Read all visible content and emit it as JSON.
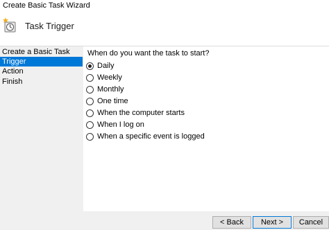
{
  "window": {
    "title": "Create Basic Task Wizard"
  },
  "header": {
    "icon": "task-scheduler-clock-icon",
    "heading": "Task Trigger"
  },
  "sidebar": {
    "items": [
      {
        "label": "Create a Basic Task",
        "selected": false
      },
      {
        "label": "Trigger",
        "selected": true
      },
      {
        "label": "Action",
        "selected": false
      },
      {
        "label": "Finish",
        "selected": false
      }
    ]
  },
  "main": {
    "question": "When do you want the task to start?",
    "options": [
      {
        "label": "Daily",
        "checked": true
      },
      {
        "label": "Weekly",
        "checked": false
      },
      {
        "label": "Monthly",
        "checked": false
      },
      {
        "label": "One time",
        "checked": false
      },
      {
        "label": "When the computer starts",
        "checked": false
      },
      {
        "label": "When I log on",
        "checked": false
      },
      {
        "label": "When a specific event is logged",
        "checked": false
      }
    ]
  },
  "footer": {
    "back_label": "< Back",
    "next_label": "Next >",
    "cancel_label": "Cancel"
  },
  "colors": {
    "selection": "#0078d7",
    "panel": "#ffffff",
    "background": "#f0f0f0"
  }
}
